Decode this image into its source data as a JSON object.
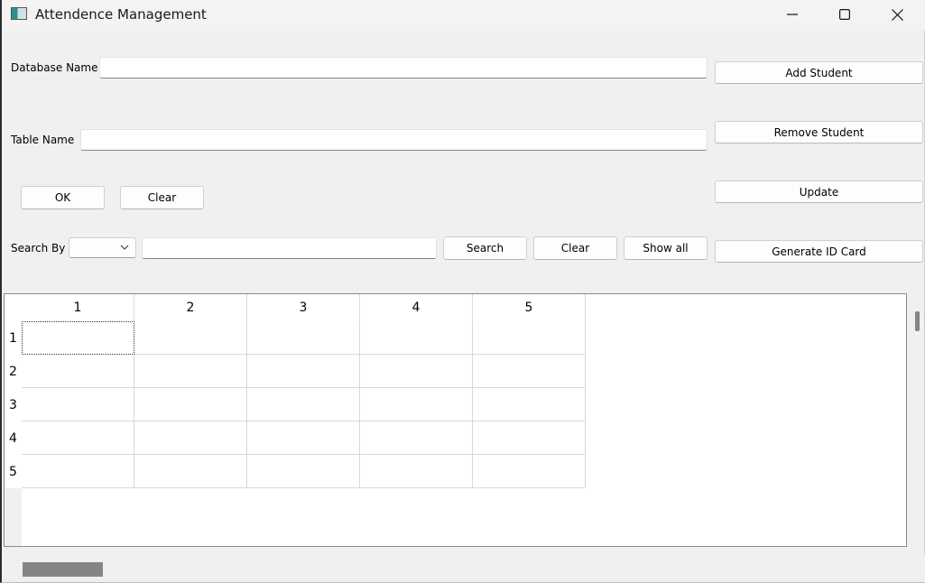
{
  "window": {
    "title": "Attendence Management",
    "icon": "app-window-icon"
  },
  "form": {
    "database_label": "Database Name",
    "database_value": "",
    "table_label": "Table Name",
    "table_value": "",
    "ok_label": "OK",
    "clear_label": "Clear",
    "search_by_label": "Search By",
    "search_by_selected": "",
    "search_value": "",
    "search_button": "Search",
    "search_clear_button": "Clear",
    "show_all_button": "Show all"
  },
  "side_actions": {
    "add_student": "Add Student",
    "remove_student": "Remove Student",
    "update": "Update",
    "generate_id_card": "Generate ID Card"
  },
  "table": {
    "column_headers": [
      "1",
      "2",
      "3",
      "4",
      "5"
    ],
    "row_headers": [
      "1",
      "2",
      "3",
      "4",
      "5"
    ],
    "cells": [
      [
        "",
        "",
        "",
        "",
        ""
      ],
      [
        "",
        "",
        "",
        "",
        ""
      ],
      [
        "",
        "",
        "",
        "",
        ""
      ],
      [
        "",
        "",
        "",
        "",
        ""
      ],
      [
        "",
        "",
        "",
        "",
        ""
      ]
    ],
    "current_cell": "1,1"
  },
  "colors": {
    "window_bg": "#f0f0f0",
    "button_bg": "#fdfdfd",
    "scroll_thumb": "#858585"
  }
}
